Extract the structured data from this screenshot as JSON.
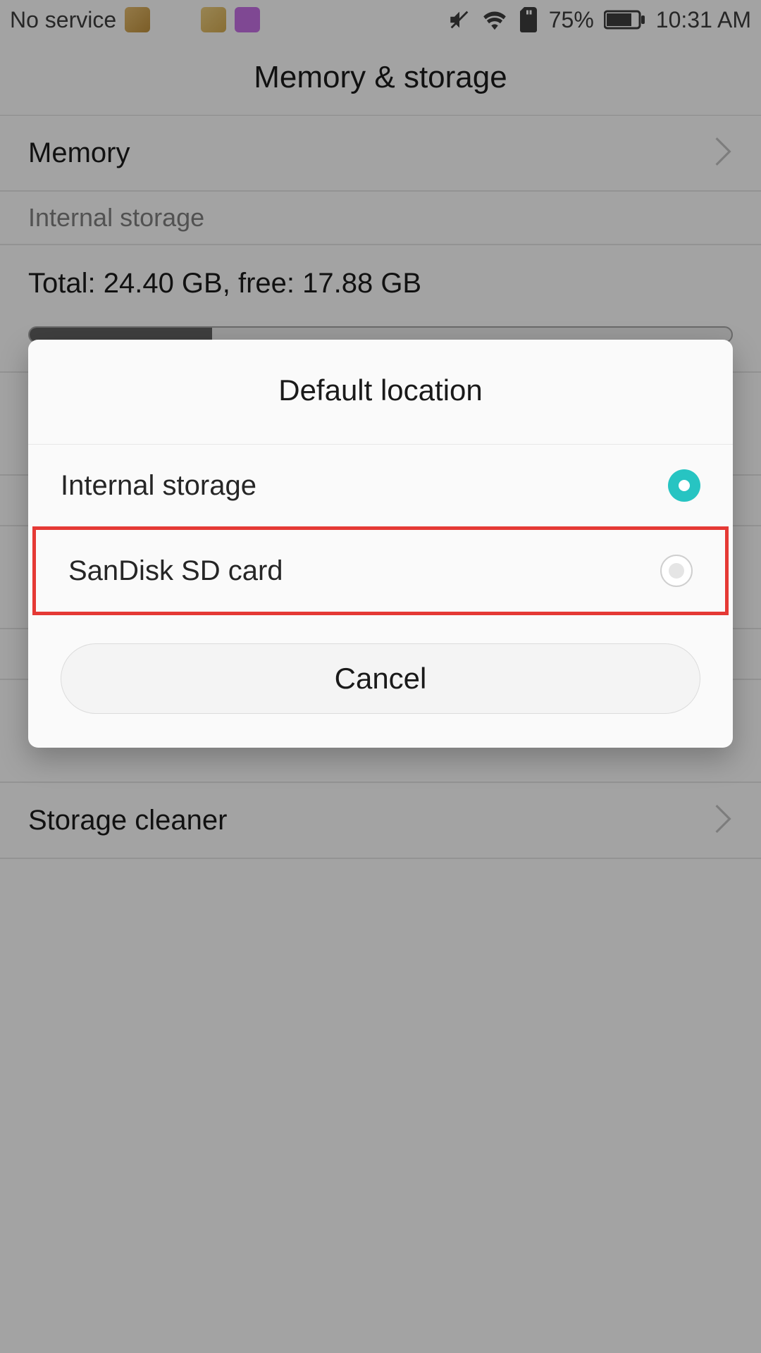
{
  "status": {
    "carrier": "No service",
    "battery_pct": "75%",
    "time": "10:31 AM"
  },
  "header": {
    "title": "Memory & storage"
  },
  "rows": {
    "memory": "Memory",
    "internal_section": "Internal storage",
    "internal_total_free": "Total: 24.40 GB, free: 17.88 GB",
    "internal_progress_pct": 26,
    "storage_cleaner": "Storage cleaner"
  },
  "dialog": {
    "title": "Default location",
    "option_internal": "Internal storage",
    "option_sd": "SanDisk SD card",
    "cancel": "Cancel",
    "selected": "internal"
  }
}
